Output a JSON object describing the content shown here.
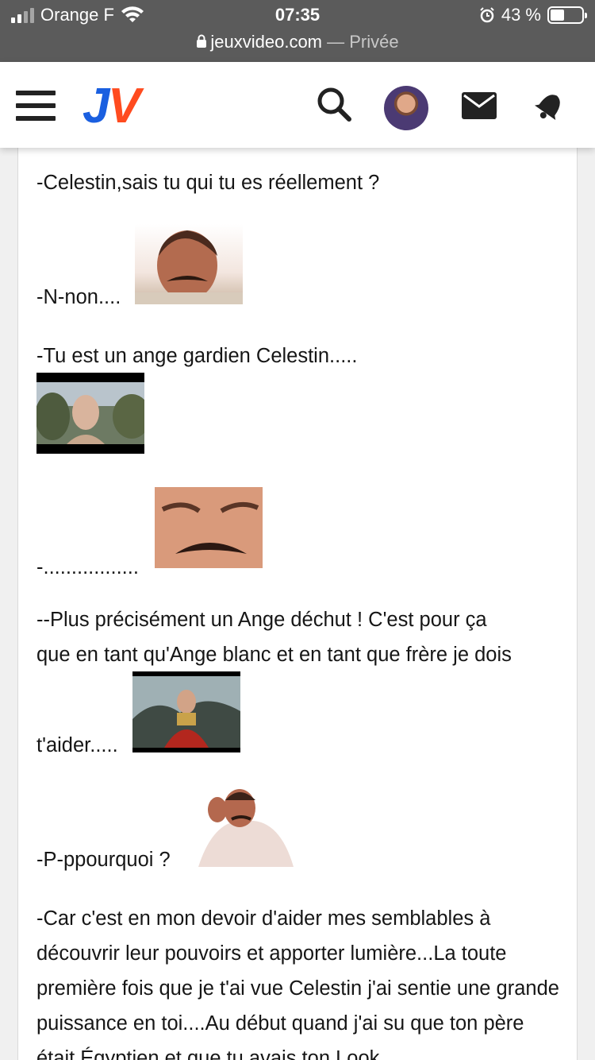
{
  "status_bar": {
    "carrier": "Orange F",
    "time": "07:35",
    "battery": "43 %",
    "url_domain": "jeuxvideo.com",
    "url_separator": " — ",
    "url_mode": "Privée"
  },
  "header": {
    "logo_j": "J",
    "logo_v": "V"
  },
  "post": {
    "line1": "-Celestin,sais tu qui tu es réellement ?",
    "line2": "-N-non....",
    "line3": "-Tu est un ange gardien Celestin.....",
    "line4": "-.................",
    "line5a": "--Plus précisément un Ange déchut ! C'est pour ça",
    "line5b": "que en tant qu'Ange blanc et en tant que frère je dois",
    "line5c": "t'aider.....",
    "line6": "-P-ppourquoi ?",
    "para7": "-Car c'est en mon devoir d'aider mes semblables à découvrir leur pouvoirs et apporter lumière...La toute première fois que je t'ai vue Celestin j'ai sentie une grande puissance en toi....Au début quand j'ai su que ton père était Égyptien et que tu avais ton Look"
  },
  "colors": {
    "status_bg": "#5b5b5b",
    "logo_blue": "#1a5fe0",
    "logo_orange": "#ff4b1f"
  }
}
